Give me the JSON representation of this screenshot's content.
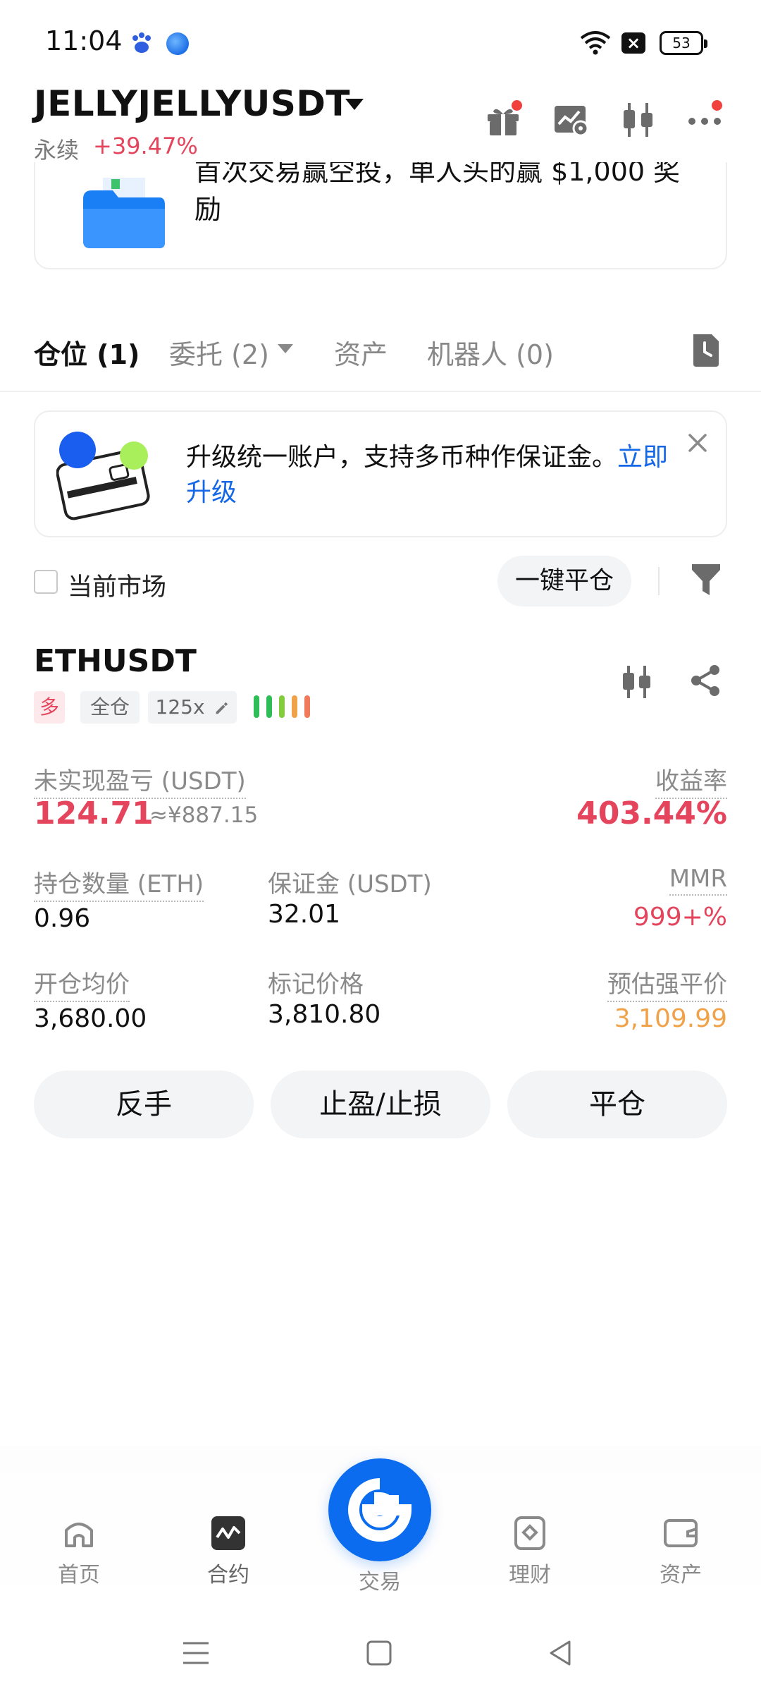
{
  "status_bar": {
    "time": "11:04",
    "battery": "53",
    "icons": [
      "baidu-icon",
      "app-icon",
      "wifi-icon",
      "x-icon",
      "battery-icon"
    ]
  },
  "header": {
    "pair": "JELLYJELLYUSDT",
    "type": "永续",
    "change": "+39.47%",
    "icons": [
      "gift-icon",
      "chart-settings-icon",
      "candlestick-icon",
      "more-icon"
    ]
  },
  "promo": {
    "text": "首次交易赢空投，单人头的赢 $1,000 奖励"
  },
  "tabs": {
    "positions": "仓位 (1)",
    "orders": "委托 (2)",
    "assets": "资产",
    "bots": "机器人 (0)"
  },
  "upgrade": {
    "text": "升级统一账户，支持多币种作保证金。",
    "link": "立即升级"
  },
  "filter": {
    "current_market": "当前市场",
    "close_all": "一键平仓"
  },
  "position": {
    "symbol": "ETHUSDT",
    "side": "多",
    "margin_mode": "全仓",
    "leverage": "125x",
    "upnl_label": "未实现盈亏 (USDT)",
    "upnl_value": "124.71",
    "upnl_cny": "≈¥887.15",
    "roe_label": "收益率",
    "roe_value": "403.44%",
    "size_label": "持仓数量 (ETH)",
    "size_value": "0.96",
    "margin_label": "保证金 (USDT)",
    "margin_value": "32.01",
    "mmr_label": "MMR",
    "mmr_value": "999+%",
    "entry_label": "开仓均价",
    "entry_value": "3,680.00",
    "mark_label": "标记价格",
    "mark_value": "3,810.80",
    "liq_label": "预估强平价",
    "liq_value": "3,109.99"
  },
  "actions": {
    "reverse": "反手",
    "tpsl": "止盈/止损",
    "close": "平仓"
  },
  "bottom_nav": {
    "home": "首页",
    "futures": "合约",
    "trade": "交易",
    "earn": "理财",
    "assets": "资产"
  },
  "colors": {
    "red": "#e5455c",
    "blue": "#1467e6",
    "orange": "#f0a24a",
    "brand": "#0b6cf0"
  }
}
